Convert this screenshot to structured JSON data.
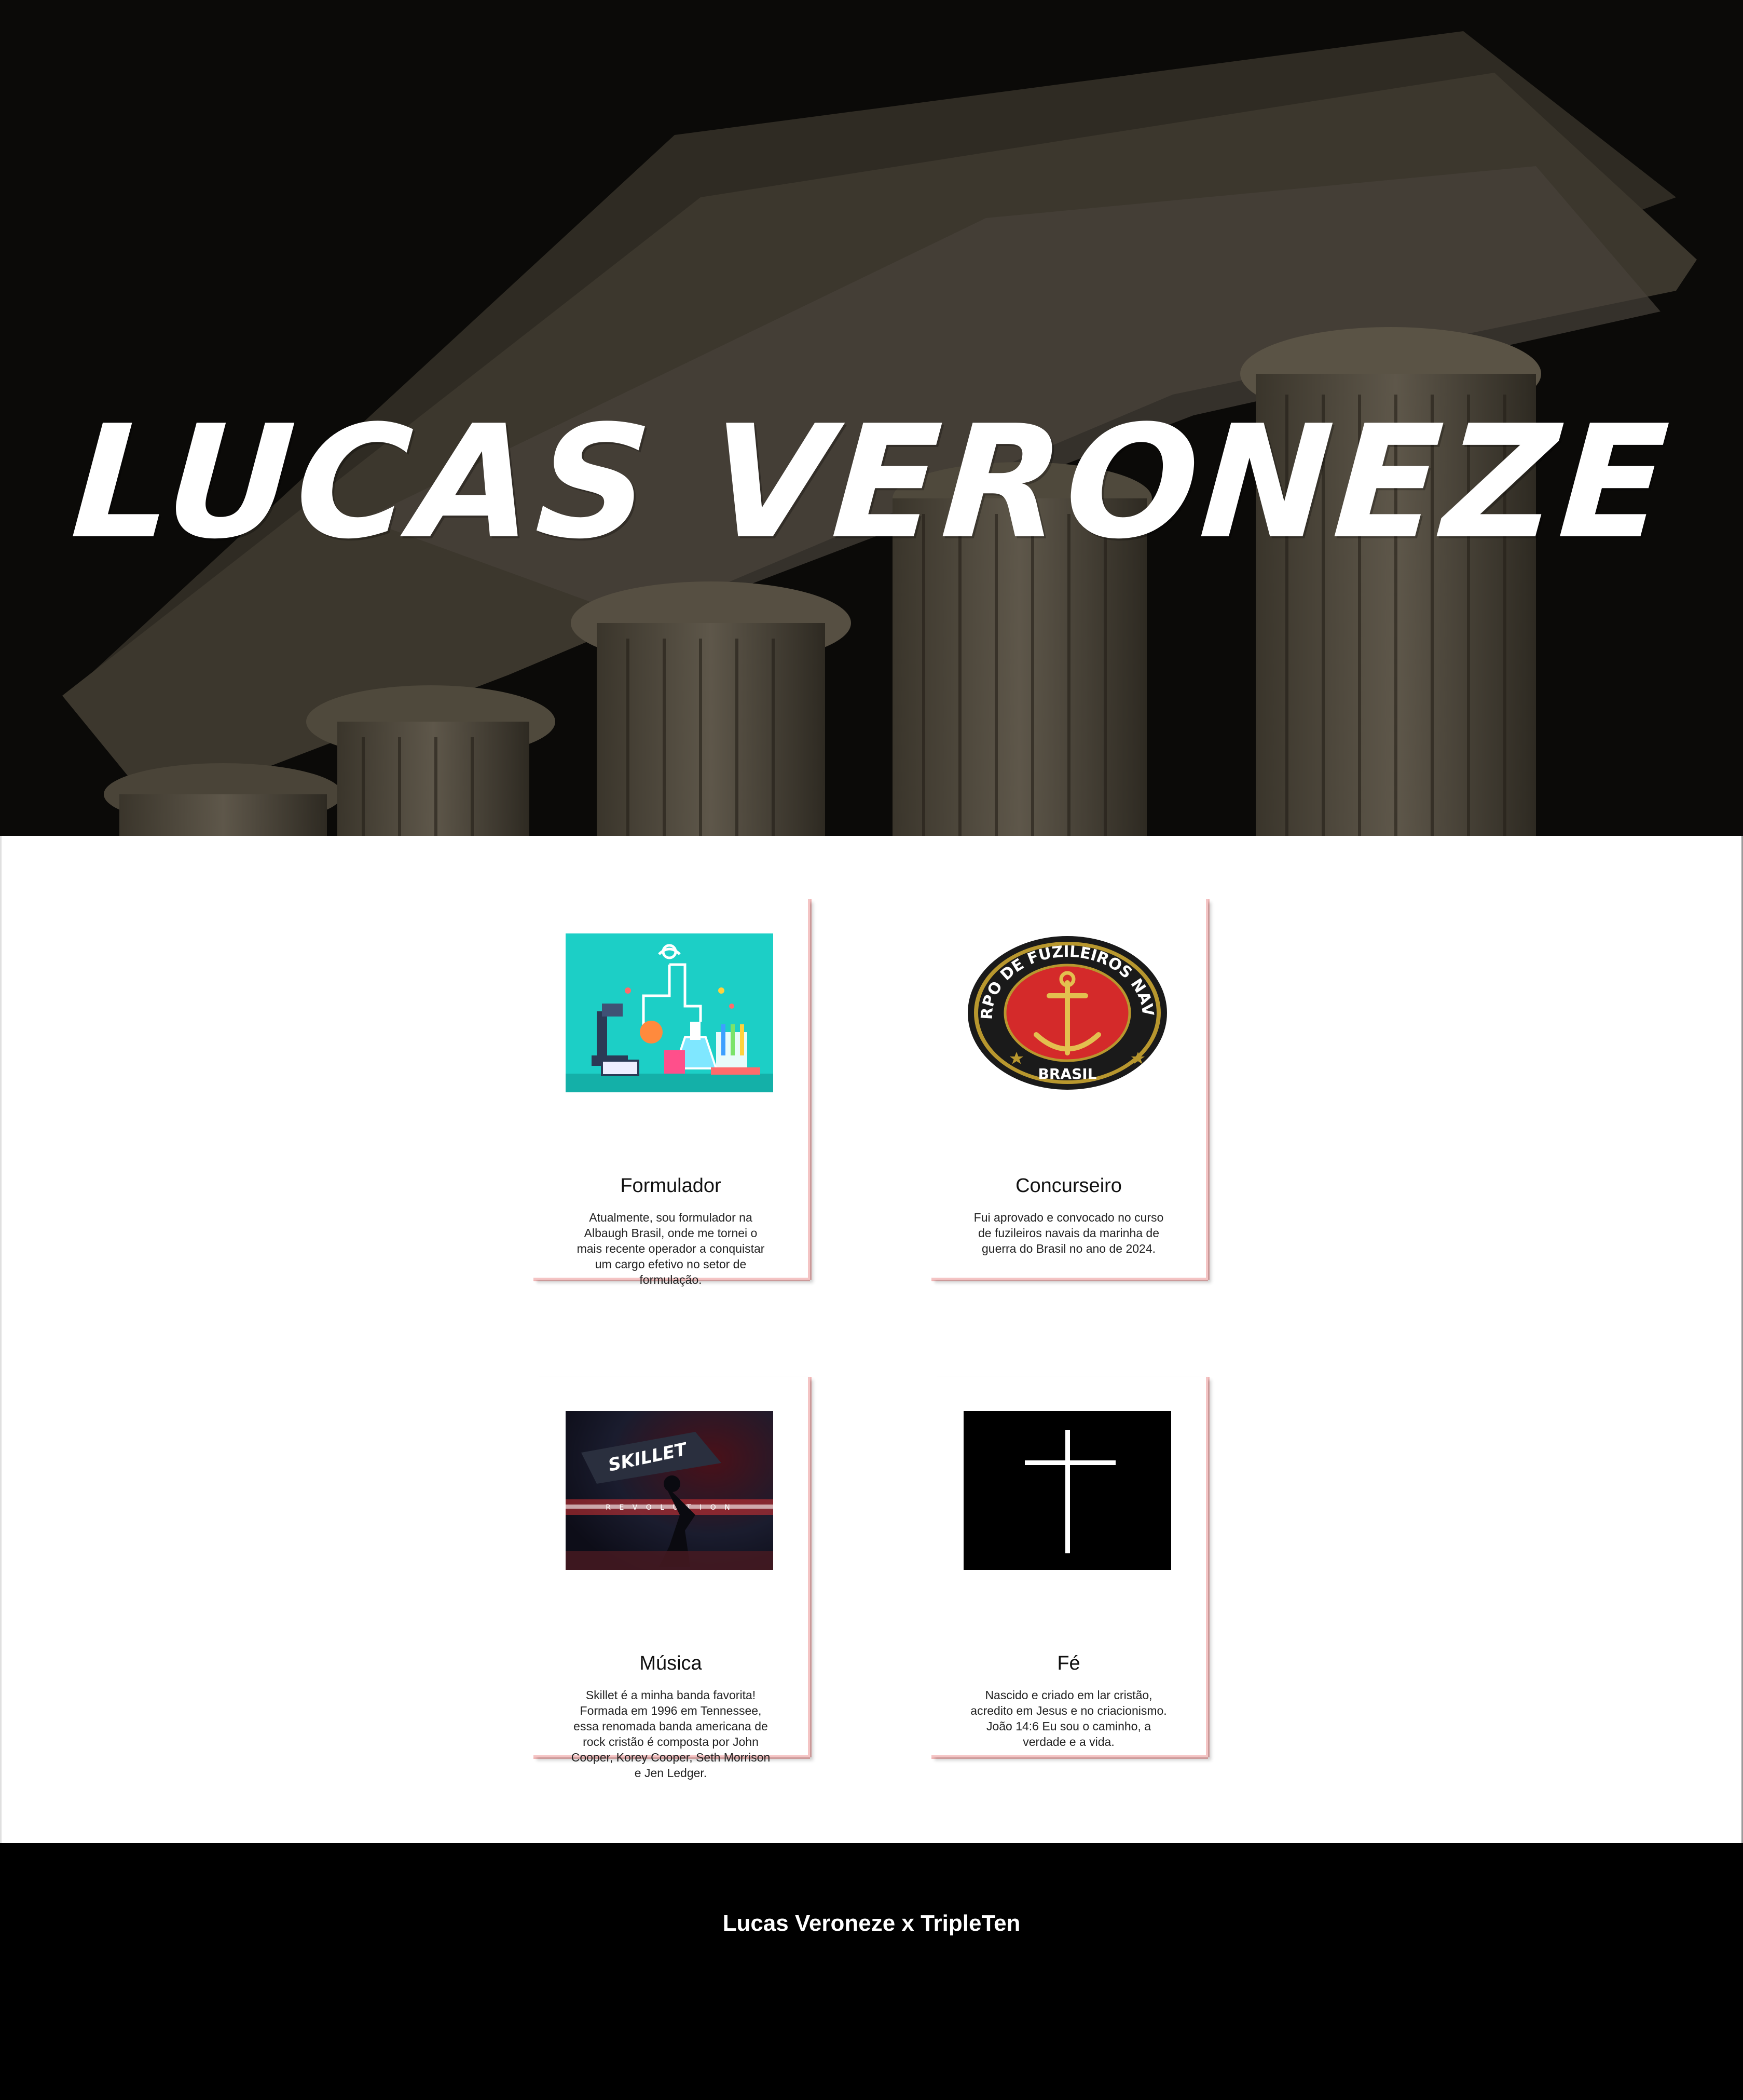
{
  "hero": {
    "title": "LUCAS VERONEZE",
    "background_icon": "greek-columns-icon",
    "background_color": "#0b0a08"
  },
  "cards": [
    {
      "title": "Formulador",
      "text": "Atualmente, sou formulador na Albaugh Brasil, onde me tornei o mais recente operador a conquistar um cargo efetivo no setor de formulação.",
      "image_icon": "laboratory-illustration-icon"
    },
    {
      "title": "Concurseiro",
      "text": "Fui aprovado e convocado no curso de fuzileiros navais da marinha de guerra do Brasil no ano de 2024.",
      "image_icon": "fuzileiros-navais-emblem-icon",
      "emblem_text": "CORPO DE FUZILEIROS NAVAIS",
      "emblem_subtext": "BRASIL"
    },
    {
      "title": "Música",
      "text": "Skillet é a minha banda favorita! Formada em 1996 em Tennessee, essa renomada banda americana de rock cristão é composta por John Cooper, Korey Cooper, Seth Morrison e Jen Ledger.",
      "image_icon": "skillet-album-cover-icon",
      "cover_logo": "SKILLET",
      "cover_text": "R E V O L U T I O N"
    },
    {
      "title": "Fé",
      "text": "Nascido e criado em lar cristão, acredito em Jesus e no criacionismo. João 14:6 Eu sou o caminho, a verdade e a vida.",
      "image_icon": "cross-icon"
    }
  ],
  "footer": {
    "text": "Lucas Veroneze x TripleTen"
  },
  "colors": {
    "card_shadow_accent": "#f4c4c4",
    "lab_background": "#1ccfc6",
    "emblem_red": "#d42a2a",
    "footer_background": "#000000"
  }
}
